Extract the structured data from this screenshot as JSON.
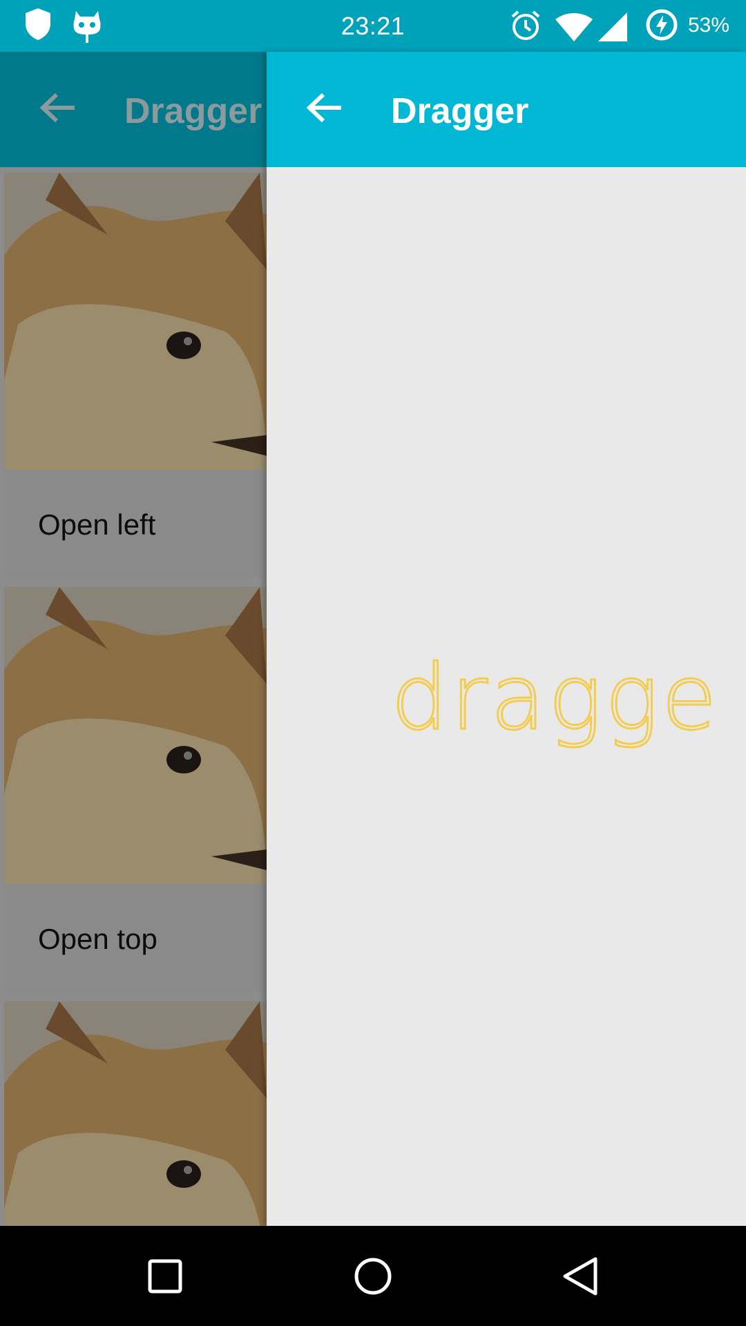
{
  "status_bar": {
    "time": "23:21",
    "battery_percent": "53%",
    "icons": [
      "shield-icon",
      "cyanogenmod-icon",
      "alarm-icon",
      "wifi-icon",
      "signal-icon",
      "battery-charging-icon"
    ]
  },
  "background_activity": {
    "toolbar_title": "Dragger",
    "cards": [
      {
        "label": "Open left",
        "image": "doge-photo"
      },
      {
        "label": "Open top",
        "image": "doge-photo"
      },
      {
        "label": "",
        "image": "doge-photo"
      }
    ]
  },
  "foreground_activity": {
    "toolbar_title": "Dragger",
    "logo_text": "dragger",
    "accent_color": "#01b7d4",
    "logo_color": "#f2cd52"
  },
  "nav_bar": {
    "buttons": [
      "recents-icon",
      "home-icon",
      "back-icon"
    ]
  }
}
